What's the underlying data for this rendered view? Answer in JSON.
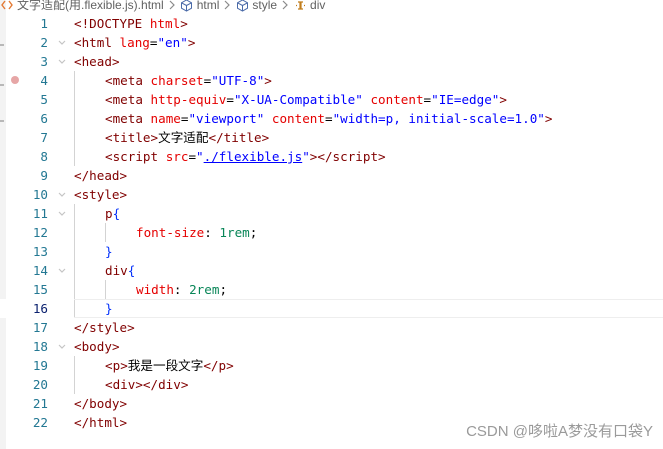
{
  "breadcrumb": {
    "items": [
      {
        "label": "文字适配(用.flexible.js).html",
        "icon": "html-file-icon"
      },
      {
        "label": "html",
        "icon": "element-icon"
      },
      {
        "label": "style",
        "icon": "element-icon"
      },
      {
        "label": "div",
        "icon": "css-selector-icon"
      }
    ]
  },
  "editor": {
    "current_line": 16,
    "breakpoint_line": 4,
    "lines": [
      {
        "n": 1,
        "indent": 0,
        "tokens": [
          [
            "punc",
            "<"
          ],
          [
            "doctype",
            "!DOCTYPE "
          ],
          [
            "attr",
            "html"
          ],
          [
            "punc",
            ">"
          ]
        ]
      },
      {
        "n": 2,
        "indent": 0,
        "fold": true,
        "tokens": [
          [
            "punc",
            "<"
          ],
          [
            "tag",
            "html"
          ],
          [
            "text",
            " "
          ],
          [
            "attr",
            "lang"
          ],
          [
            "text",
            "="
          ],
          [
            "str",
            "\"en\""
          ],
          [
            "punc",
            ">"
          ]
        ]
      },
      {
        "n": 3,
        "indent": 0,
        "fold": true,
        "tokens": [
          [
            "punc",
            "<"
          ],
          [
            "tag",
            "head"
          ],
          [
            "punc",
            ">"
          ]
        ]
      },
      {
        "n": 4,
        "indent": 1,
        "tokens": [
          [
            "punc",
            "<"
          ],
          [
            "tag",
            "meta"
          ],
          [
            "text",
            " "
          ],
          [
            "attr",
            "charset"
          ],
          [
            "text",
            "="
          ],
          [
            "str",
            "\"UTF-8\""
          ],
          [
            "punc",
            ">"
          ]
        ]
      },
      {
        "n": 5,
        "indent": 1,
        "tokens": [
          [
            "punc",
            "<"
          ],
          [
            "tag",
            "meta"
          ],
          [
            "text",
            " "
          ],
          [
            "attr",
            "http-equiv"
          ],
          [
            "text",
            "="
          ],
          [
            "str",
            "\"X-UA-Compatible\""
          ],
          [
            "text",
            " "
          ],
          [
            "attr",
            "content"
          ],
          [
            "text",
            "="
          ],
          [
            "str",
            "\"IE=edge\""
          ],
          [
            "punc",
            ">"
          ]
        ]
      },
      {
        "n": 6,
        "indent": 1,
        "tokens": [
          [
            "punc",
            "<"
          ],
          [
            "tag",
            "meta"
          ],
          [
            "text",
            " "
          ],
          [
            "attr",
            "name"
          ],
          [
            "text",
            "="
          ],
          [
            "str",
            "\"viewport\""
          ],
          [
            "text",
            " "
          ],
          [
            "attr",
            "content"
          ],
          [
            "text",
            "="
          ],
          [
            "str",
            "\"width=p, initial-scale=1.0\""
          ],
          [
            "punc",
            ">"
          ]
        ]
      },
      {
        "n": 7,
        "indent": 1,
        "tokens": [
          [
            "punc",
            "<"
          ],
          [
            "tag",
            "title"
          ],
          [
            "punc",
            ">"
          ],
          [
            "text",
            "文字适配"
          ],
          [
            "punc",
            "</"
          ],
          [
            "tag",
            "title"
          ],
          [
            "punc",
            ">"
          ]
        ]
      },
      {
        "n": 8,
        "indent": 1,
        "tokens": [
          [
            "punc",
            "<"
          ],
          [
            "tag",
            "script"
          ],
          [
            "text",
            " "
          ],
          [
            "attr",
            "src"
          ],
          [
            "text",
            "="
          ],
          [
            "str",
            "\""
          ],
          [
            "link",
            "./flexible.js"
          ],
          [
            "str",
            "\""
          ],
          [
            "punc",
            "></"
          ],
          [
            "tag",
            "script"
          ],
          [
            "punc",
            ">"
          ]
        ]
      },
      {
        "n": 9,
        "indent": 0,
        "tokens": [
          [
            "punc",
            "</"
          ],
          [
            "tag",
            "head"
          ],
          [
            "punc",
            ">"
          ]
        ]
      },
      {
        "n": 10,
        "indent": 0,
        "fold": true,
        "tokens": [
          [
            "punc",
            "<"
          ],
          [
            "tag",
            "style"
          ],
          [
            "punc",
            ">"
          ]
        ]
      },
      {
        "n": 11,
        "indent": 1,
        "fold": true,
        "tokens": [
          [
            "sel",
            "p"
          ],
          [
            "brace",
            "{"
          ]
        ]
      },
      {
        "n": 12,
        "indent": 2,
        "tokens": [
          [
            "prop",
            "font-size"
          ],
          [
            "text",
            ": "
          ],
          [
            "num",
            "1rem"
          ],
          [
            "text",
            ";"
          ]
        ]
      },
      {
        "n": 13,
        "indent": 1,
        "tokens": [
          [
            "brace",
            "}"
          ]
        ]
      },
      {
        "n": 14,
        "indent": 1,
        "fold": true,
        "tokens": [
          [
            "sel",
            "div"
          ],
          [
            "brace",
            "{"
          ]
        ]
      },
      {
        "n": 15,
        "indent": 2,
        "tokens": [
          [
            "prop",
            "width"
          ],
          [
            "text",
            ": "
          ],
          [
            "num",
            "2rem"
          ],
          [
            "text",
            ";"
          ]
        ]
      },
      {
        "n": 16,
        "indent": 1,
        "tokens": [
          [
            "brace",
            "}"
          ]
        ]
      },
      {
        "n": 17,
        "indent": 0,
        "tokens": [
          [
            "punc",
            "</"
          ],
          [
            "tag",
            "style"
          ],
          [
            "punc",
            ">"
          ]
        ]
      },
      {
        "n": 18,
        "indent": 0,
        "fold": true,
        "tokens": [
          [
            "punc",
            "<"
          ],
          [
            "tag",
            "body"
          ],
          [
            "punc",
            ">"
          ]
        ]
      },
      {
        "n": 19,
        "indent": 1,
        "tokens": [
          [
            "punc",
            "<"
          ],
          [
            "tag",
            "p"
          ],
          [
            "punc",
            ">"
          ],
          [
            "text",
            "我是一段文字"
          ],
          [
            "punc",
            "</"
          ],
          [
            "tag",
            "p"
          ],
          [
            "punc",
            ">"
          ]
        ]
      },
      {
        "n": 20,
        "indent": 1,
        "tokens": [
          [
            "punc",
            "<"
          ],
          [
            "tag",
            "div"
          ],
          [
            "punc",
            "></"
          ],
          [
            "tag",
            "div"
          ],
          [
            "punc",
            ">"
          ]
        ]
      },
      {
        "n": 21,
        "indent": 0,
        "tokens": [
          [
            "punc",
            "</"
          ],
          [
            "tag",
            "body"
          ],
          [
            "punc",
            ">"
          ]
        ]
      },
      {
        "n": 22,
        "indent": 0,
        "tokens": [
          [
            "punc",
            "</"
          ],
          [
            "tag",
            "html"
          ],
          [
            "punc",
            ">"
          ]
        ]
      }
    ]
  },
  "watermark": {
    "text": "CSDN @哆啦A梦没有口袋Y"
  },
  "colors": {
    "line_number": "#237893",
    "tag": "#800000",
    "attribute": "#e50000",
    "string": "#0000ff",
    "number": "#098658",
    "brace": "#0431fa",
    "breakpoint": "#e6a6a6"
  }
}
